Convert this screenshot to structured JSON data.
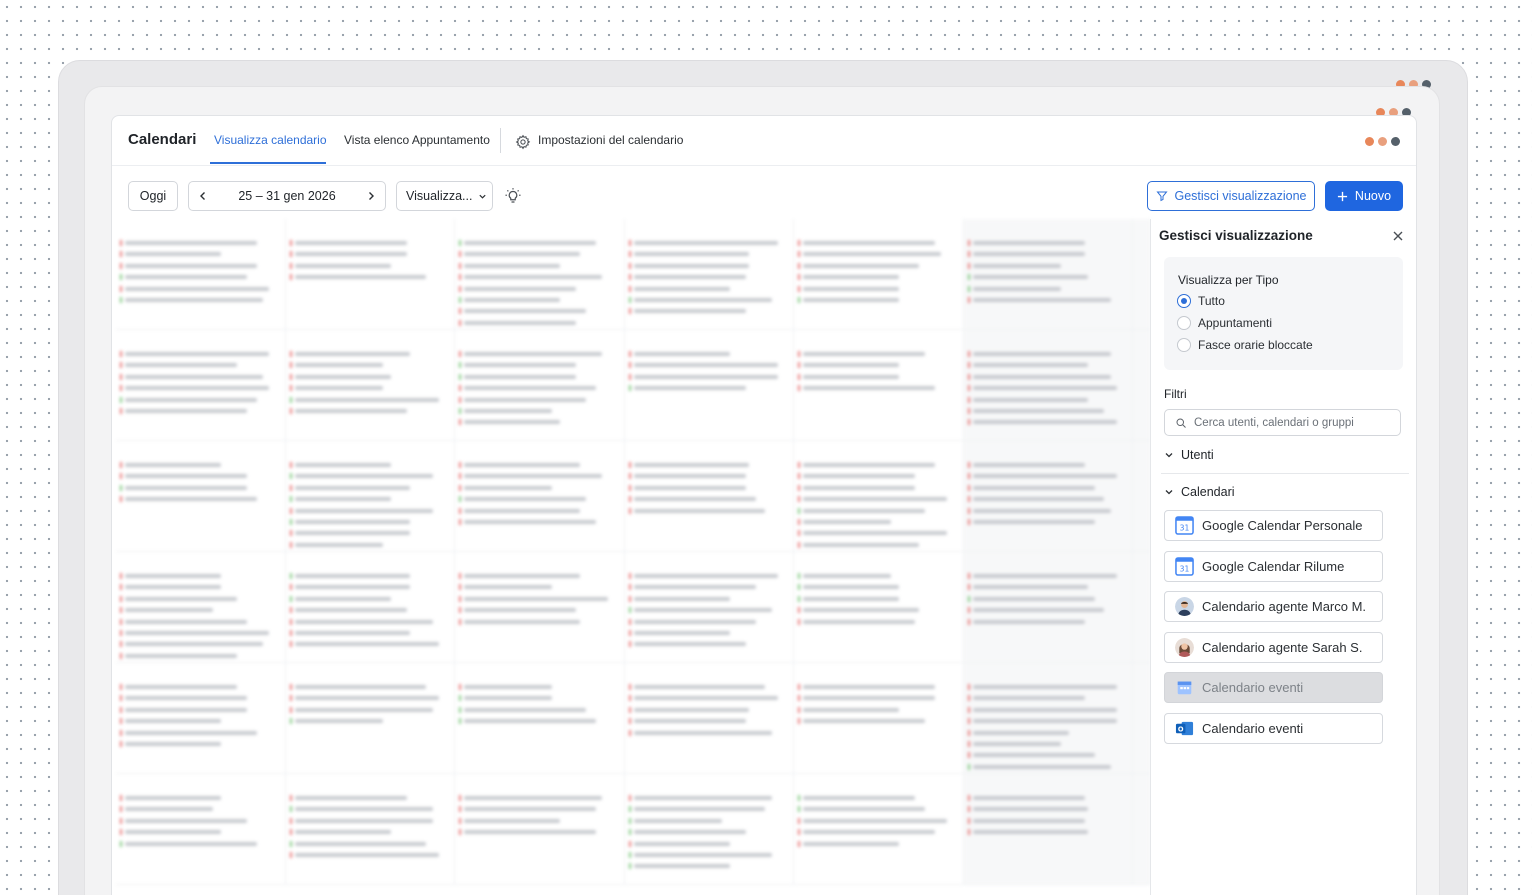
{
  "header": {
    "title": "Calendari",
    "tabs": [
      {
        "label": "Visualizza calendario",
        "active": true
      },
      {
        "label": "Vista elenco Appuntamento",
        "active": false
      }
    ],
    "settings_label": "Impostazioni del calendario"
  },
  "toolbar": {
    "today_label": "Oggi",
    "date_range": "25 – 31 gen 2026",
    "view_select": "Visualizza...",
    "manage_view_label": "Gestisci visualizzazione",
    "new_label": "Nuovo"
  },
  "panel": {
    "title": "Gestisci visualizzazione",
    "view_by_type": {
      "title": "Visualizza per Tipo",
      "options": [
        "Tutto",
        "Appuntamenti",
        "Fasce orarie bloccate"
      ],
      "selected": "Tutto"
    },
    "filters_label": "Filtri",
    "search_placeholder": "Cerca utenti, calendari o gruppi",
    "users_label": "Utenti",
    "calendars_label": "Calendari",
    "calendars": [
      {
        "label": "Google Calendar Personale",
        "icon": "google-calendar-icon",
        "disabled": false
      },
      {
        "label": "Google Calendar Rilume",
        "icon": "google-calendar-icon",
        "disabled": false
      },
      {
        "label": "Calendario agente Marco M.",
        "icon": "avatar-male",
        "disabled": false
      },
      {
        "label": "Calendario agente Sarah S.",
        "icon": "avatar-female",
        "disabled": false
      },
      {
        "label": "Calendario eventi",
        "icon": "event-calendar-icon",
        "disabled": true
      },
      {
        "label": "Calendario eventi",
        "icon": "outlook-calendar-icon",
        "disabled": false
      }
    ]
  },
  "colors": {
    "accent": "#2e6fd8",
    "primary_button": "#1f66e0",
    "dot_orange": "#e8875a",
    "dot_salmon": "#e9a07e",
    "dot_dark": "#55606a"
  }
}
